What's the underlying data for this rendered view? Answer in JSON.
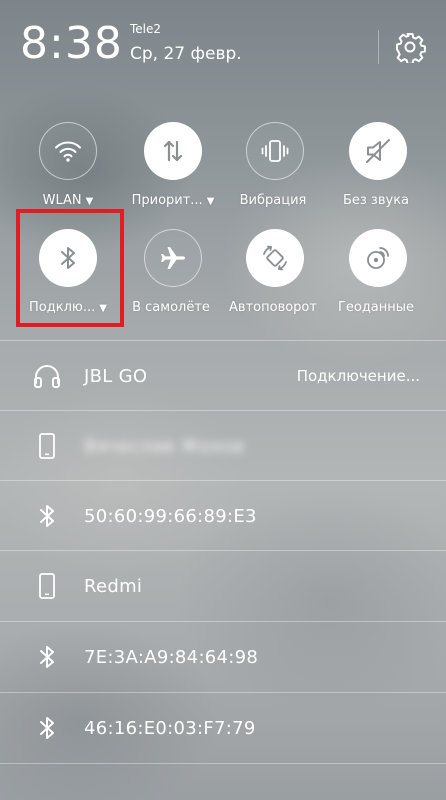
{
  "status": {
    "time": "8:38",
    "operator": "Tele2",
    "date": "Ср, 27 февр."
  },
  "icons": {
    "settings": "gear-icon"
  },
  "toggles": [
    {
      "label": "WLAN",
      "caret": "▼",
      "state": "off",
      "icon": "wifi-icon"
    },
    {
      "label": "Приорит...",
      "caret": "▼",
      "state": "on",
      "icon": "data-priority-icon"
    },
    {
      "label": "Вибрация",
      "caret": "",
      "state": "off",
      "icon": "vibration-icon"
    },
    {
      "label": "Без звука",
      "caret": "",
      "state": "on",
      "icon": "mute-icon"
    },
    {
      "label": "Подклю...",
      "caret": "▼",
      "state": "on",
      "icon": "bluetooth-icon"
    },
    {
      "label": "В самолёте",
      "caret": "",
      "state": "off",
      "icon": "airplane-icon"
    },
    {
      "label": "Автоповорот",
      "caret": "",
      "state": "on",
      "icon": "rotate-icon"
    },
    {
      "label": "Геоданные",
      "caret": "",
      "state": "on",
      "icon": "location-icon"
    }
  ],
  "devices": [
    {
      "icon": "headphones-icon",
      "name": "JBL GO",
      "status": "Подключение..."
    },
    {
      "icon": "phone-icon",
      "name": "Вячеслав Жохов",
      "status": "",
      "blurred": true
    },
    {
      "icon": "bluetooth-icon",
      "name": "50:60:99:66:89:E3",
      "status": ""
    },
    {
      "icon": "phone-icon",
      "name": "Redmi",
      "status": ""
    },
    {
      "icon": "bluetooth-icon",
      "name": "7E:3A:A9:84:64:98",
      "status": ""
    },
    {
      "icon": "bluetooth-icon",
      "name": "46:16:E0:03:F7:79",
      "status": ""
    }
  ],
  "colors": {
    "highlight": "#e21d22",
    "toggle_on_bg": "#ffffff",
    "toggle_on_icon": "#8a8f92"
  }
}
